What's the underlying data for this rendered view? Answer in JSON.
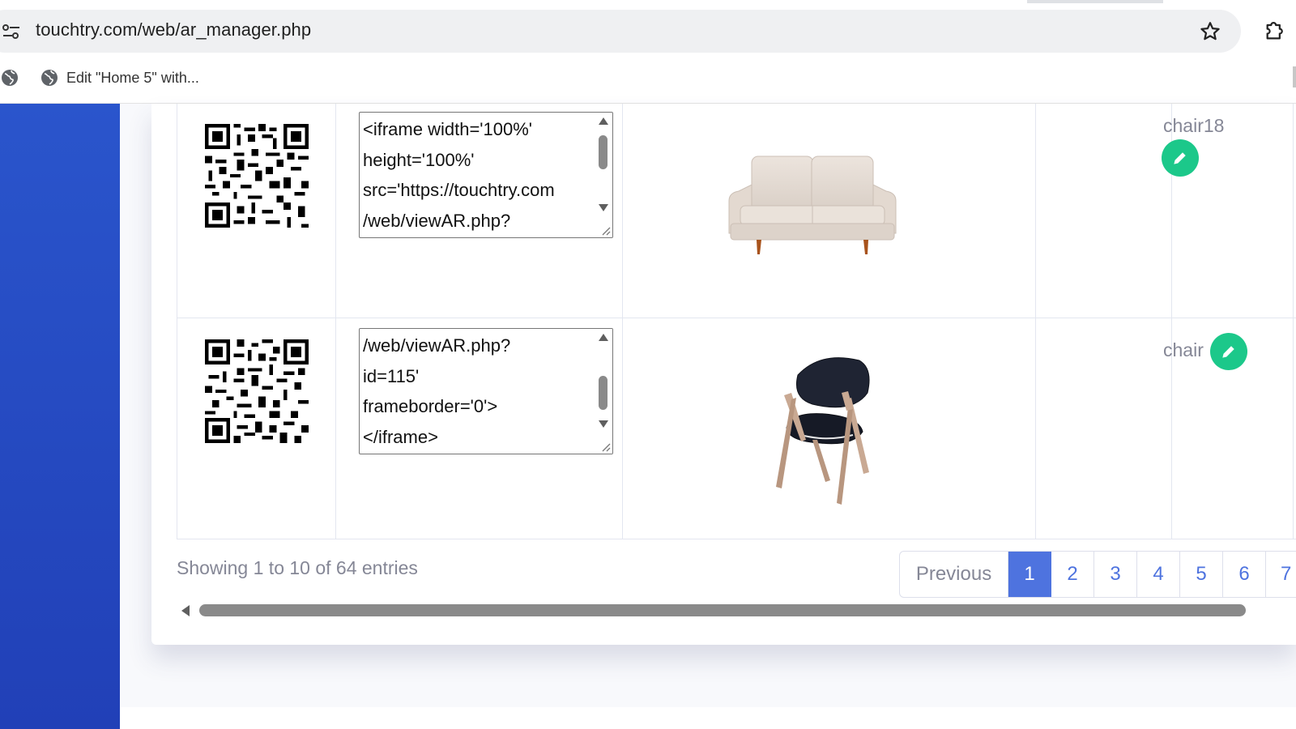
{
  "browser": {
    "url": "touchtry.com/web/ar_manager.php",
    "bookmark_label": "Edit \"Home 5\" with..."
  },
  "icons": {
    "site_info": "site-settings-icon",
    "bookmark": "star-icon",
    "extensions": "puzzle-extension-icon",
    "globe": "globe-icon",
    "edit": "pencil-icon"
  },
  "colors": {
    "sidebar": "#2545c4",
    "edit_button": "#1cc88a",
    "active_page": "#4e73df",
    "muted_text": "#858796"
  },
  "table": {
    "rows": [
      {
        "embed_code_visible": "<iframe width='100%'\nheight='100%'\nsrc='https://touchtry.com\n/web/viewAR.php?",
        "model_image": "beige-sofa",
        "name": "chair18"
      },
      {
        "embed_code_visible": "/web/viewAR.php?\nid=115'\nframeborder='0'>\n</iframe>",
        "model_image": "dark-chair",
        "name": "chair"
      }
    ]
  },
  "pagination": {
    "info": "Showing 1 to 10 of 64 entries",
    "previous_label": "Previous",
    "pages": [
      "1",
      "2",
      "3",
      "4",
      "5",
      "6",
      "7"
    ],
    "active_page": "1"
  }
}
